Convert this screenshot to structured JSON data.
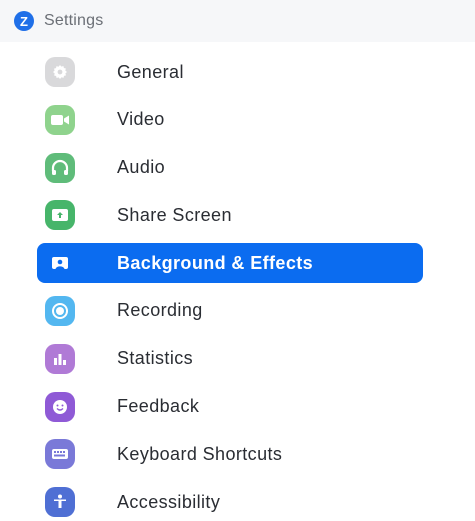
{
  "window": {
    "title": "Settings",
    "app_icon_letter": "Z",
    "accent_color": "#0b6cf0"
  },
  "menu": {
    "selected_index": 4,
    "items": [
      {
        "id": "general",
        "label": "General",
        "icon": "gear-icon",
        "color": "#d9d9db"
      },
      {
        "id": "video",
        "label": "Video",
        "icon": "video-camera-icon",
        "color": "#8fd38d"
      },
      {
        "id": "audio",
        "label": "Audio",
        "icon": "headphones-icon",
        "color": "#5fbc7a"
      },
      {
        "id": "share-screen",
        "label": "Share Screen",
        "icon": "share-screen-icon",
        "color": "#47b56a"
      },
      {
        "id": "background-effects",
        "label": "Background & Effects",
        "icon": "background-person-icon",
        "color": "#0b6cf0"
      },
      {
        "id": "recording",
        "label": "Recording",
        "icon": "record-icon",
        "color": "#53b7f0"
      },
      {
        "id": "statistics",
        "label": "Statistics",
        "icon": "bar-chart-icon",
        "color": "#b07ad6"
      },
      {
        "id": "feedback",
        "label": "Feedback",
        "icon": "smiley-icon",
        "color": "#8f5ad6"
      },
      {
        "id": "keyboard-shortcuts",
        "label": "Keyboard Shortcuts",
        "icon": "keyboard-icon",
        "color": "#7a79d8"
      },
      {
        "id": "accessibility",
        "label": "Accessibility",
        "icon": "accessibility-icon",
        "color": "#4f6fd4"
      }
    ]
  }
}
